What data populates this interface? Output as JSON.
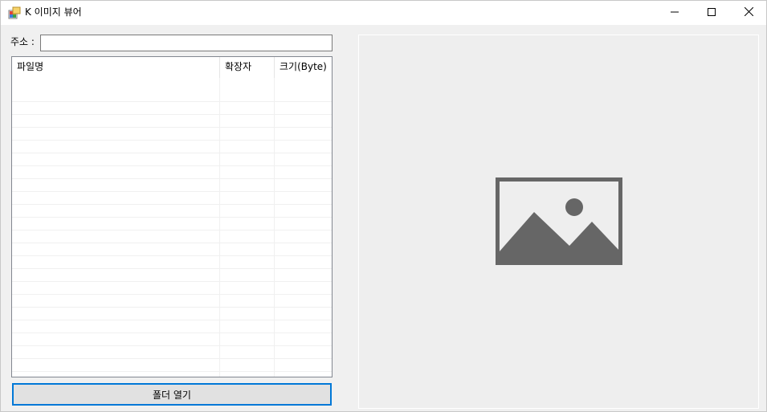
{
  "window": {
    "title": "K 이미지 뷰어",
    "icon": "app-window-icon",
    "controls": {
      "minimize_icon": "minimize-icon",
      "maximize_icon": "maximize-icon",
      "close_icon": "close-icon"
    }
  },
  "address": {
    "label": "주소 :",
    "value": "",
    "placeholder": ""
  },
  "file_list": {
    "columns": [
      "파일명",
      "확장자",
      "크기(Byte)"
    ],
    "rows": []
  },
  "open_folder_button": {
    "label": "폴더 열기"
  },
  "preview": {
    "icon": "image-placeholder-icon",
    "icon_color": "#666666"
  },
  "colors": {
    "accent": "#0078d7",
    "window_bg": "#f0f0f0",
    "preview_bg": "#eeeeee"
  }
}
